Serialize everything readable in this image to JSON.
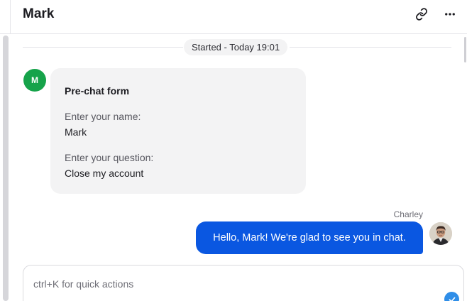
{
  "header": {
    "title": "Mark",
    "icons": {
      "link": "link-icon",
      "more": "more-horizontal-icon"
    }
  },
  "divider": {
    "started_text": "Started - Today 19:01"
  },
  "customer": {
    "avatar_initial": "M",
    "avatar_color": "#16a34a"
  },
  "prechat_form": {
    "title": "Pre-chat form",
    "questions": [
      {
        "label": "Enter your name:",
        "answer": "Mark"
      },
      {
        "label": "Enter your question:",
        "answer": "Close my account"
      }
    ]
  },
  "agent_message": {
    "author": "Charley",
    "text": "Hello, Mark! We're glad to see you in chat.",
    "bubble_color": "#0a57e1"
  },
  "composer": {
    "placeholder": "ctrl+K for quick actions",
    "value": ""
  },
  "colors": {
    "accent": "#0a57e1",
    "card_bg": "#f3f3f4",
    "check": "#2f8ee8"
  }
}
